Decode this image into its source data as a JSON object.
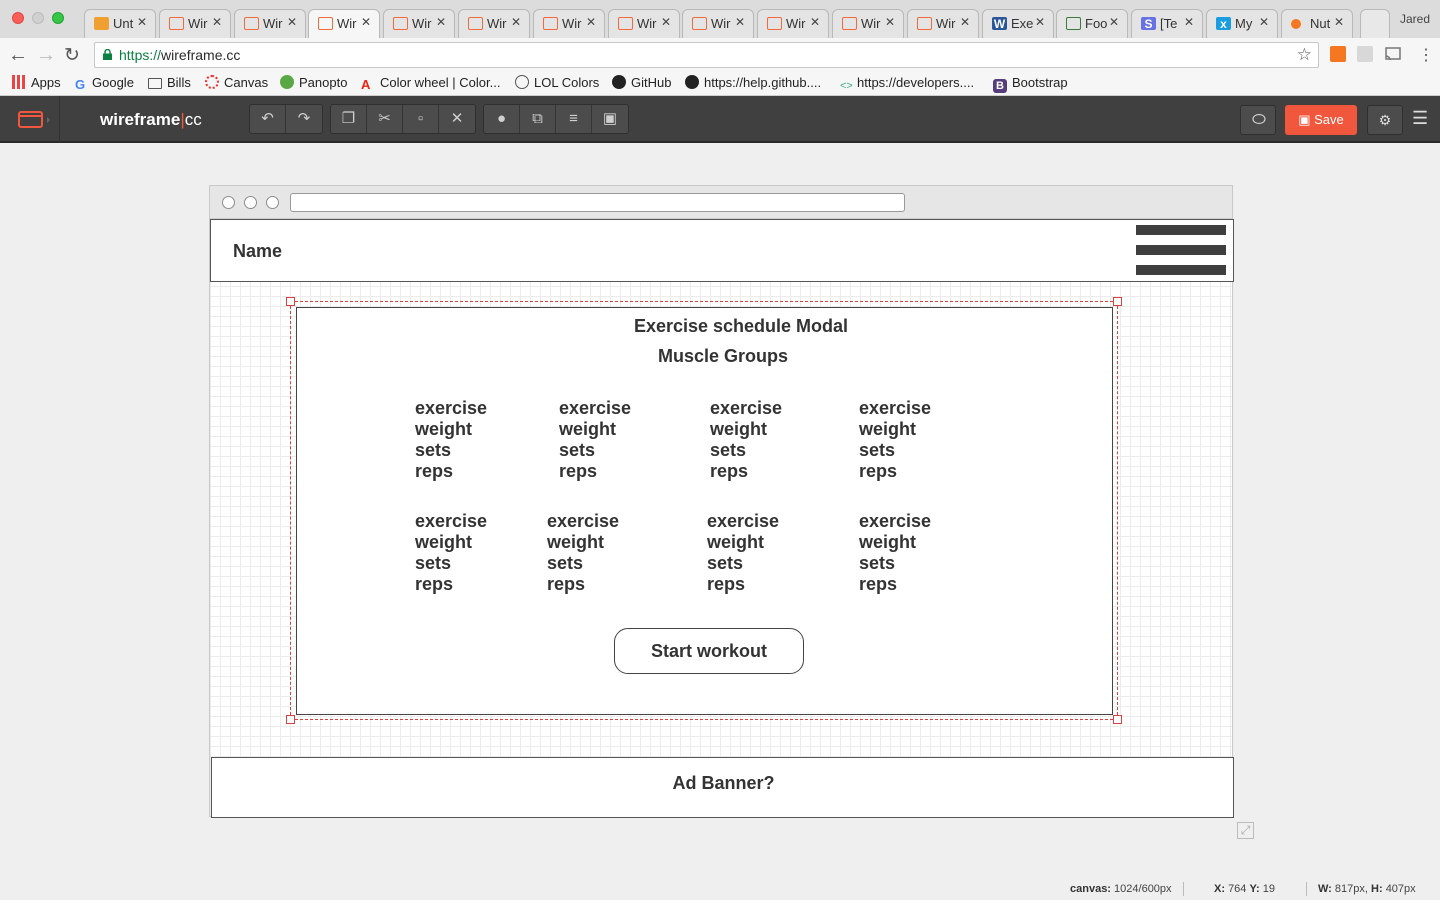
{
  "browser": {
    "tabs": [
      {
        "label": "Unt",
        "icon": "triangle-app-icon"
      },
      {
        "label": "Wir",
        "icon": "wireframe-icon"
      },
      {
        "label": "Wir",
        "icon": "wireframe-icon"
      },
      {
        "label": "Wir",
        "icon": "wireframe-icon",
        "active": true
      },
      {
        "label": "Wir",
        "icon": "wireframe-icon"
      },
      {
        "label": "Wir",
        "icon": "wireframe-icon"
      },
      {
        "label": "Wir",
        "icon": "wireframe-icon"
      },
      {
        "label": "Wir",
        "icon": "wireframe-icon"
      },
      {
        "label": "Wir",
        "icon": "wireframe-icon"
      },
      {
        "label": "Wir",
        "icon": "wireframe-icon"
      },
      {
        "label": "Wir",
        "icon": "wireframe-icon"
      },
      {
        "label": "Wir",
        "icon": "wireframe-icon"
      },
      {
        "label": "Exe",
        "icon": "word-icon"
      },
      {
        "label": "Foo",
        "icon": "usda-icon"
      },
      {
        "label": "[Te",
        "icon": "s-app-icon"
      },
      {
        "label": "My",
        "icon": "x-app-icon"
      },
      {
        "label": "Nut",
        "icon": "hubspot-icon"
      }
    ],
    "profile_name": "Jared",
    "url_scheme": "https://",
    "url_host": "wireframe.cc",
    "bookmarks": [
      "Apps",
      "Google",
      "Bills",
      "Canvas",
      "Panopto",
      "Color wheel | Color...",
      "LOL Colors",
      "GitHub",
      "https://help.github....",
      "https://developers....",
      "Bootstrap"
    ]
  },
  "app": {
    "brand_main": "wireframe",
    "brand_sep": "|",
    "brand_cc": "cc",
    "save_label": "Save",
    "accent": "#f0573c"
  },
  "wireframe": {
    "header_name": "Name",
    "modal_title": "Exercise schedule Modal",
    "modal_subtitle": "Muscle Groups",
    "exercise_grid": [
      [
        "exercise",
        "weight",
        "sets",
        "reps"
      ],
      [
        "exercise",
        "weight",
        "sets",
        "reps"
      ],
      [
        "exercise",
        "weight",
        "sets",
        "reps"
      ],
      [
        "exercise",
        "weight",
        "sets",
        "reps"
      ],
      [
        "exercise",
        "weight",
        "sets",
        "reps"
      ],
      [
        "exercise",
        "weight",
        "sets",
        "reps"
      ],
      [
        "exercise",
        "weight",
        "sets",
        "reps"
      ],
      [
        "exercise",
        "weight",
        "sets",
        "reps"
      ]
    ],
    "start_button": "Start workout",
    "ad_banner": "Ad Banner?"
  },
  "status": {
    "canvas_label": "canvas:",
    "canvas_value": "1024/600px",
    "x_label": "X:",
    "x_value": "764",
    "y_label": "Y:",
    "y_value": "19",
    "w_label": "W:",
    "w_value": "817px,",
    "h_label": "H:",
    "h_value": "407px"
  }
}
